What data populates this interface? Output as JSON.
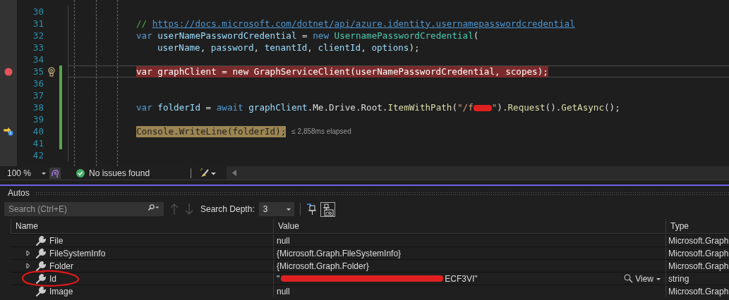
{
  "editor": {
    "lines": [
      {
        "number": "30"
      },
      {
        "number": "31",
        "tokens": [
          {
            "kind": "comment",
            "text": "// "
          },
          {
            "kind": "link",
            "text": "https://docs.microsoft.com/dotnet/api/azure.identity.usernamepasswordcredential"
          }
        ]
      },
      {
        "number": "32",
        "tokens": [
          {
            "kind": "keyword",
            "text": "var "
          },
          {
            "kind": "identifier",
            "text": "userNamePasswordCredential"
          },
          {
            "kind": "plain",
            "text": " = "
          },
          {
            "kind": "keyword",
            "text": "new "
          },
          {
            "kind": "type",
            "text": "UsernamePasswordCredential"
          },
          {
            "kind": "plain",
            "text": "("
          }
        ]
      },
      {
        "number": "33",
        "indent": true,
        "tokens": [
          {
            "kind": "identifier",
            "text": "userName"
          },
          {
            "kind": "plain",
            "text": ", "
          },
          {
            "kind": "identifier",
            "text": "password"
          },
          {
            "kind": "plain",
            "text": ", "
          },
          {
            "kind": "identifier",
            "text": "tenantId"
          },
          {
            "kind": "plain",
            "text": ", "
          },
          {
            "kind": "identifier",
            "text": "clientId"
          },
          {
            "kind": "plain",
            "text": ", "
          },
          {
            "kind": "identifier",
            "text": "options"
          },
          {
            "kind": "plain",
            "text": ");"
          }
        ]
      },
      {
        "number": "34"
      },
      {
        "number": "35",
        "breakpoint": true,
        "lightbulb": true,
        "changed": true,
        "current": true,
        "tokens": [
          {
            "kind": "plain",
            "text": "var graphClient = new GraphServiceClient(userNamePasswordCredential, scopes);"
          }
        ]
      },
      {
        "number": "36",
        "changed": true
      },
      {
        "number": "37",
        "changed": true
      },
      {
        "number": "38",
        "changed": true,
        "tokens": [
          {
            "kind": "keyword",
            "text": "var "
          },
          {
            "kind": "identifier",
            "text": "folderId"
          },
          {
            "kind": "plain",
            "text": " = "
          },
          {
            "kind": "keyword",
            "text": "await "
          },
          {
            "kind": "identifier",
            "text": "graphClient"
          },
          {
            "kind": "plain",
            "text": ".Me.Drive.Root."
          },
          {
            "kind": "method",
            "text": "ItemWithPath"
          },
          {
            "kind": "plain",
            "text": "("
          },
          {
            "kind": "string",
            "text": "\"/f"
          },
          {
            "kind": "redacted"
          },
          {
            "kind": "string",
            "text": "\""
          },
          {
            "kind": "plain",
            "text": ")."
          },
          {
            "kind": "method",
            "text": "Request"
          },
          {
            "kind": "plain",
            "text": "()."
          },
          {
            "kind": "method",
            "text": "GetAsync"
          },
          {
            "kind": "plain",
            "text": "();"
          }
        ]
      },
      {
        "number": "39",
        "changed": true
      },
      {
        "number": "40",
        "current_statement": true,
        "changed": true,
        "elapsed": "≤ 2,858ms elapsed",
        "tokens": [
          {
            "kind": "plain",
            "text": "Console.WriteLine(folderId);"
          }
        ]
      },
      {
        "number": "41",
        "changed": true
      },
      {
        "number": "42"
      }
    ]
  },
  "status_bar": {
    "zoom": "100 %",
    "issues": "No issues found"
  },
  "autos": {
    "title": "Autos",
    "search": {
      "placeholder": "Search (Ctrl+E)"
    },
    "depth_label": "Search Depth:",
    "depth": "3",
    "columns": [
      "Name",
      "Value",
      "Type"
    ],
    "rows": [
      {
        "name": "File",
        "expandable": false,
        "value": "null",
        "type": "Microsoft.Graph"
      },
      {
        "name": "FileSystemInfo",
        "expandable": true,
        "value": "{Microsoft.Graph.FileSystemInfo}",
        "type": "Microsoft.Graph"
      },
      {
        "name": "Folder",
        "expandable": true,
        "value": "{Microsoft.Graph.Folder}",
        "type": "Microsoft.Graph"
      },
      {
        "name": "Id",
        "expandable": false,
        "circled": true,
        "value_redacted": true,
        "value": "\"",
        "value_tail": "ECF3VI\"",
        "view": "View",
        "type": "string"
      },
      {
        "name": "Image",
        "expandable": false,
        "value": "null",
        "type": "Microsoft.Graph"
      }
    ]
  }
}
